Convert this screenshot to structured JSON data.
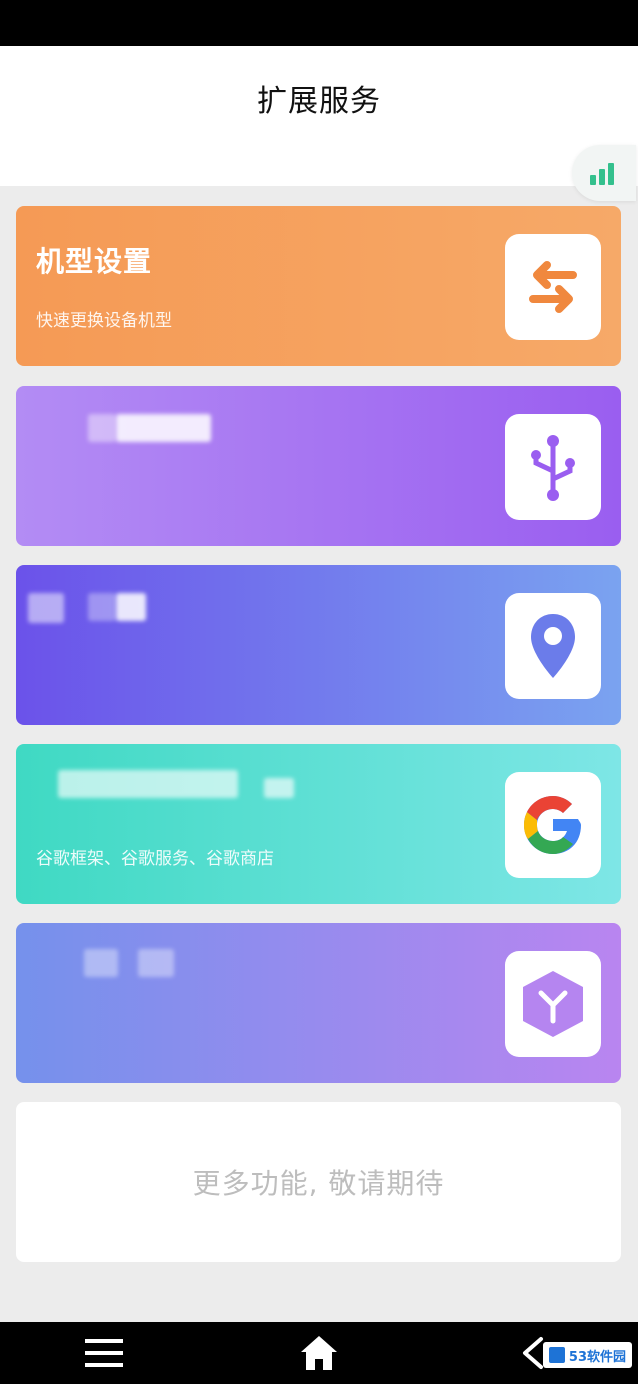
{
  "header": {
    "title": "扩展服务"
  },
  "cards": [
    {
      "title": "机型设置",
      "description": "快速更换设备机型",
      "icon": "swap-arrows-icon"
    },
    {
      "title": "",
      "description": "",
      "icon": "usb-icon"
    },
    {
      "title": "",
      "description": "",
      "icon": "location-pin-icon"
    },
    {
      "title": "",
      "description": "谷歌框架、谷歌服务、谷歌商店",
      "icon": "google-icon"
    },
    {
      "title": "",
      "description": "",
      "icon": "cube-icon"
    }
  ],
  "more": {
    "label": "更多功能, 敬请期待"
  },
  "nav": {
    "items": [
      "menu-icon",
      "home-icon",
      "back-icon"
    ]
  },
  "watermark": {
    "text": "53软件园"
  },
  "colors": {
    "card1": "#f59a55",
    "card2": "#9a5ef0",
    "card3": "#6b52ea",
    "card4": "#3fd9c3",
    "card5": "#b985f0",
    "signal": "#34c08d"
  }
}
